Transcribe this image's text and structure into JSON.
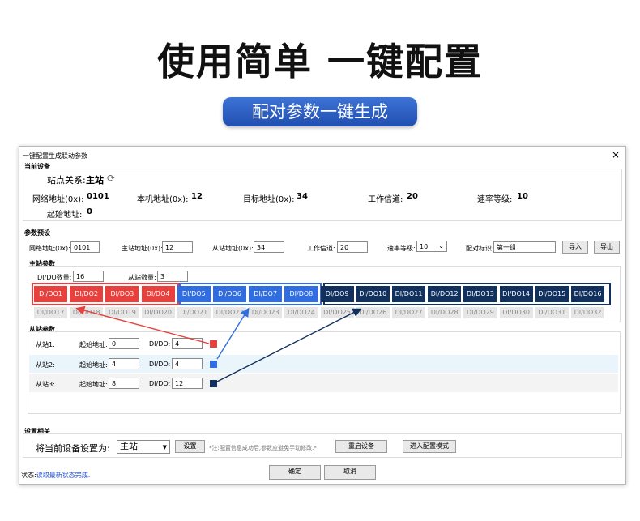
{
  "banner": {
    "headline": "使用简单  一键配置",
    "pill": "配对参数一键生成"
  },
  "window": {
    "title": "一键配置生成联动参数",
    "close_glyph": "×"
  },
  "current_device": {
    "section": "当前设备",
    "relation_label": "站点关系:",
    "relation_value": "主站",
    "network_label": "网络地址(0x):",
    "network_value": "0101",
    "local_label": "本机地址(0x):",
    "local_value": "12",
    "target_label": "目标地址(0x):",
    "target_value": "34",
    "channel_label": "工作信道:",
    "channel_value": "20",
    "rate_label": "速率等级:",
    "rate_value": "10",
    "start_label": "起始地址:",
    "start_value": "0"
  },
  "preset": {
    "section": "参数预设",
    "network_label": "网络地址(0x):",
    "network_value": "0101",
    "master_label": "主站地址(0x):",
    "master_value": "12",
    "slave_label": "从站地址(0x):",
    "slave_value": "34",
    "channel_label": "工作信道:",
    "channel_value": "20",
    "rate_label": "速率等级:",
    "rate_value": "10",
    "pair_label": "配对标识:",
    "pair_value": "第一组",
    "import_button": "导入",
    "export_button": "导出"
  },
  "master": {
    "section": "主站参数",
    "dido_count_label": "DI/DO数量:",
    "dido_count_value": "16",
    "slave_count_label": "从站数量:",
    "slave_count_value": "3",
    "row1": [
      "DI/DO1",
      "DI/DO2",
      "DI/DO3",
      "DI/DO4",
      "DI/DO5",
      "DI/DO6",
      "DI/DO7",
      "DI/DO8",
      "DI/DO9",
      "DI/DO10",
      "DI/DO11",
      "DI/DO12",
      "DI/DO13",
      "DI/DO14",
      "DI/DO15",
      "DI/DO16"
    ],
    "row2": [
      "DI/DO17",
      "DI/DO18",
      "DI/DO19",
      "DI/DO20",
      "DI/DO21",
      "DI/DO22",
      "DI/DO23",
      "DI/DO24",
      "DI/DO25",
      "DI/DO26",
      "DI/DO27",
      "DI/DO28",
      "DI/DO29",
      "DI/DO30",
      "DI/DO31",
      "DI/DO32"
    ]
  },
  "slaves": {
    "section": "从站参数",
    "rows": [
      {
        "name": "从站1:",
        "start_label": "起始地址:",
        "start_value": "0",
        "dido_label": "DI/DO:",
        "dido_value": "4",
        "color": "#e8403c"
      },
      {
        "name": "从站2:",
        "start_label": "起始地址:",
        "start_value": "4",
        "dido_label": "DI/DO:",
        "dido_value": "4",
        "color": "#2f6de0"
      },
      {
        "name": "从站3:",
        "start_label": "起始地址:",
        "start_value": "8",
        "dido_label": "DI/DO:",
        "dido_value": "12",
        "color": "#11305e"
      }
    ]
  },
  "settings": {
    "section": "设置相关",
    "set_as_label": "将当前设备设置为:",
    "set_as_value": "主站",
    "set_button": "设置",
    "note": "*注:配置信息成功后,参数应避免手动修改.*",
    "restart_button": "重启设备",
    "config_mode_button": "进入配置模式"
  },
  "footer": {
    "status_label": "状态:",
    "status_text": "读取最新状态完成.",
    "ok_button": "确定",
    "cancel_button": "取消"
  },
  "colors": {
    "red": "#e8403c",
    "blue": "#2f6de0",
    "navy": "#11305e",
    "pill": "#2a5cc4"
  }
}
